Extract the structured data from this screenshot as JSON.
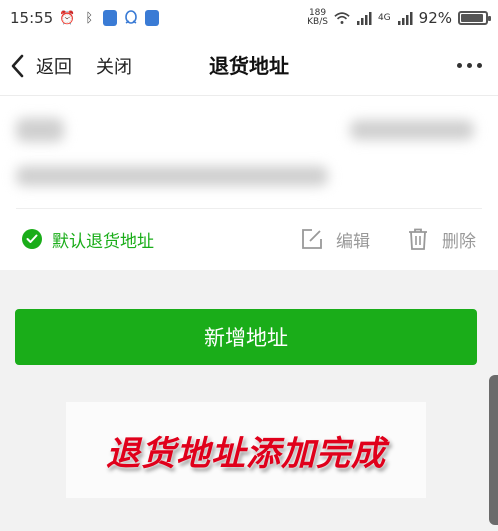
{
  "status_bar": {
    "time": "15:55",
    "net_speed_value": "189",
    "net_speed_unit": "KB/S",
    "signal_label": "4G",
    "battery": "92%",
    "battery_level": 0.92
  },
  "nav": {
    "back_label": "返回",
    "close_label": "关闭",
    "title": "退货地址"
  },
  "address": {
    "default_label": "默认退货地址",
    "edit_label": "编辑",
    "delete_label": "删除"
  },
  "add_button_label": "新增地址",
  "banner_text": "退货地址添加完成",
  "colors": {
    "accent_green": "#1aad19",
    "banner_red": "#e0001b"
  },
  "icons": [
    "back-arrow-icon",
    "more-dots-icon",
    "check-circle-icon",
    "edit-icon",
    "trash-icon",
    "wifi-icon",
    "signal-icon",
    "battery-icon",
    "alarm-icon",
    "bluetooth-icon",
    "qq-icon"
  ]
}
